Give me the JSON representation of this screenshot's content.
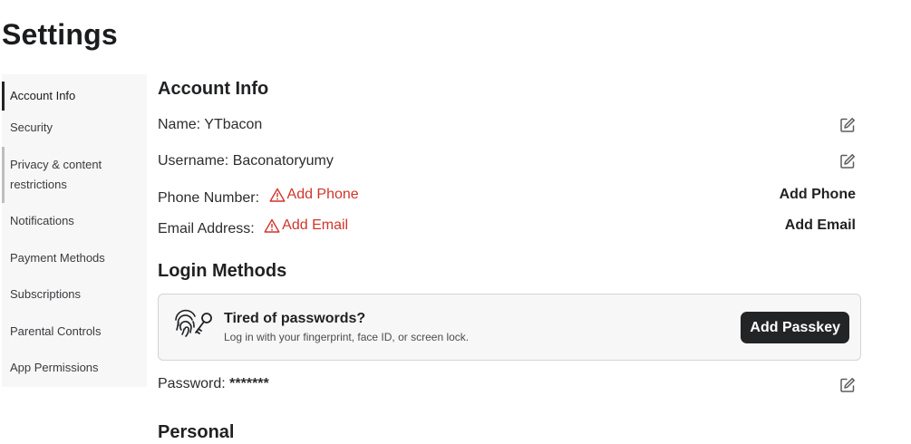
{
  "page": {
    "title": "Settings"
  },
  "sidebar": {
    "items": [
      {
        "label": "Account Info"
      },
      {
        "label": "Security"
      },
      {
        "label": "Privacy & content restrictions"
      },
      {
        "label": "Notifications"
      },
      {
        "label": "Payment Methods"
      },
      {
        "label": "Subscriptions"
      },
      {
        "label": "Parental Controls"
      },
      {
        "label": "App Permissions"
      }
    ]
  },
  "account_info": {
    "title": "Account Info",
    "name_label": "Name:",
    "name_value": "YTbacon",
    "username_label": "Username:",
    "username_value": "Baconatoryumy",
    "phone_label": "Phone Number:",
    "phone_warning": "Add Phone",
    "phone_action": "Add Phone",
    "email_label": "Email Address:",
    "email_warning": "Add Email",
    "email_action": "Add Email"
  },
  "login_methods": {
    "title": "Login Methods",
    "passkey_title": "Tired of passwords?",
    "passkey_subtitle": "Log in with your fingerprint, face ID, or screen lock.",
    "passkey_button": "Add Passkey",
    "password_label": "Password:",
    "password_value": "*******"
  },
  "personal": {
    "title": "Personal"
  },
  "colors": {
    "warning": "#d2342b",
    "button_bg": "#222426",
    "sidebar_bg": "#f7f7f8"
  },
  "icons": [
    "edit-icon",
    "warning-icon",
    "fingerprint-key-icon"
  ]
}
